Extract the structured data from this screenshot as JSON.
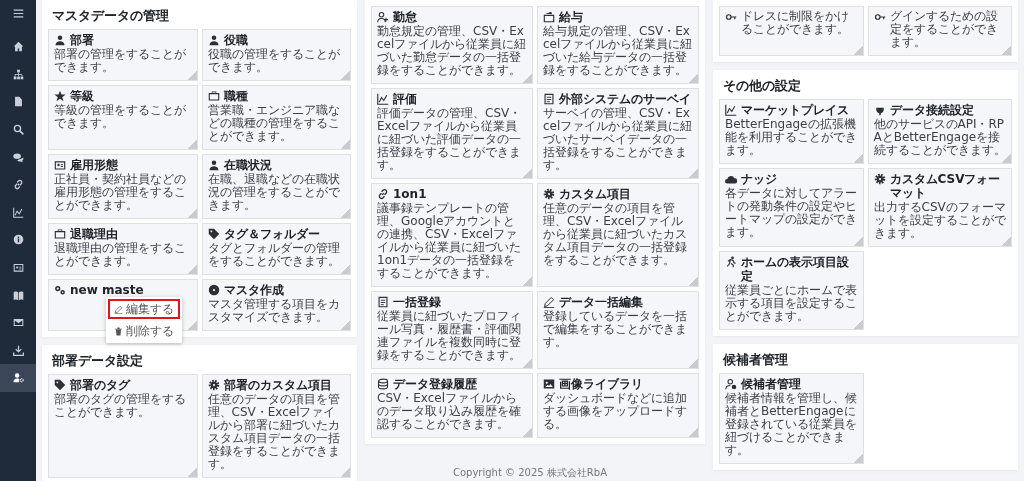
{
  "sidebar": {
    "items": [
      {
        "selected": false
      },
      {
        "selected": false
      },
      {
        "selected": false
      },
      {
        "selected": false
      },
      {
        "selected": false
      },
      {
        "selected": false
      },
      {
        "selected": false
      },
      {
        "selected": false
      },
      {
        "selected": false
      },
      {
        "selected": false
      },
      {
        "selected": false
      },
      {
        "selected": false
      },
      {
        "selected": true
      }
    ]
  },
  "columns": [
    {
      "panels": [
        {
          "title": "マスタデータの管理",
          "cards": [
            {
              "title": "部署",
              "description": "部署の管理をすることができます。"
            },
            {
              "title": "役職",
              "description": "役職の管理をすることができます。"
            },
            {
              "title": "等級",
              "description": "等級の管理をすることができます。"
            },
            {
              "title": "職種",
              "description": "営業職・エンジニア職などの職種の管理をすることができます。"
            },
            {
              "title": "雇用形態",
              "description": "正社員・契約社員などの雇用形態の管理をすることができます。"
            },
            {
              "title": "在職状況",
              "description": "在職、退職などの在職状況の管理をすることができます。"
            },
            {
              "title": "退職理由",
              "description": "退職理由の管理をすることができます。"
            },
            {
              "title": "タグ＆フォルダー",
              "description": "タグとフォルダーの管理をすることができます。"
            },
            {
              "title": "new maste",
              "menu": [
                {
                  "label": "編集する",
                  "selected": true
                },
                {
                  "label": "削除する",
                  "selected": false
                }
              ]
            },
            {
              "title": "マスタ作成",
              "description": "マスタ管理する項目をカスタマイズできます。"
            }
          ]
        },
        {
          "title": "部署データ設定",
          "cards": [
            {
              "title": "部署のタグ",
              "description": "部署のタグの管理をすることができます。"
            },
            {
              "title": "部署のカスタム項目",
              "description": "任意のデータの項目を管理、CSV・Excelファイルから部署に紐づいたカスタム項目データの一括登録をすることができます。"
            }
          ]
        }
      ]
    },
    {
      "panels": [
        {
          "cards": [
            {
              "title": "勤怠",
              "description": "勤怠規定の管理、CSV・Excelファイルから従業員に紐づいた勤怠データの一括登録をすることができます。"
            },
            {
              "title": "給与",
              "description": "給与規定の管理、CSV・Excelファイルから従業員に紐づいた給与データの一括登録をすることができます。"
            },
            {
              "title": "評価",
              "description": "評価データの管理、CSV・Excelファイルから従業員に紐づいた評価データの一括登録をすることができます。"
            },
            {
              "title": "外部システムのサーベイ",
              "description": "サーベイの管理、CSV・Excelファイルから従業員に紐づいたサーベイデータの一括登録をすることができます。"
            },
            {
              "title": "1on1",
              "description": "議事録テンプレートの管理、Googleアカウントとの連携、CSV・Excelファイルから従業員に紐づいた1on1データの一括登録をすることができます。"
            },
            {
              "title": "カスタム項目",
              "description": "任意のデータの項目を管理、CSV・Excelファイルから従業員に紐づいたカスタム項目データの一括登録をすることができます。"
            },
            {
              "title": "一括登録",
              "description": "従業員に紐づいたプロフィール写真・履歴書・評価関連ファイルを複数同時に登録をすることができます。"
            },
            {
              "title": "データ一括編集",
              "description": "登録しているデータを一括で編集をすることができます。"
            },
            {
              "title": "データ登録履歴",
              "description": "CSV・Excelファイルからのデータ取り込み履歴を確認することができます。"
            },
            {
              "title": "画像ライブラリ",
              "description": "ダッシュボードなどに追加する画像をアップロードする。"
            }
          ]
        }
      ]
    },
    {
      "panels": [
        {
          "cards": [
            {
              "description": "ドレスに制限をかけることができます。"
            },
            {
              "description": "グインするための設定をすることができます。"
            }
          ]
        },
        {
          "title": "その他の設定",
          "cards": [
            {
              "title": "マーケットプレイス",
              "description": "BetterEngageの拡張機能を利用することができます。"
            },
            {
              "title": "データ接続設定",
              "description": "他のサービスのAPI・RPAとBetterEngageを接続することができます。"
            },
            {
              "title": "ナッジ",
              "description": "各データに対してアラートの発動条件の設定やヒートマップの設定ができます。"
            },
            {
              "title": "カスタムCSVフォーマット",
              "description": "出力するCSVのフォーマットを設定することができます。"
            },
            {
              "title": "ホームの表示項目設定",
              "description": "従業員ごとにホームで表示する項目を設定することができます。"
            }
          ]
        },
        {
          "title": "候補者管理",
          "cards": [
            {
              "title": "候補者管理",
              "description": "候補者情報を管理し、候補者とBetterEngageに登録されている従業員を紐づけることができます。"
            }
          ]
        }
      ]
    }
  ],
  "footer": "Copyright © 2025 株式会社RbA"
}
